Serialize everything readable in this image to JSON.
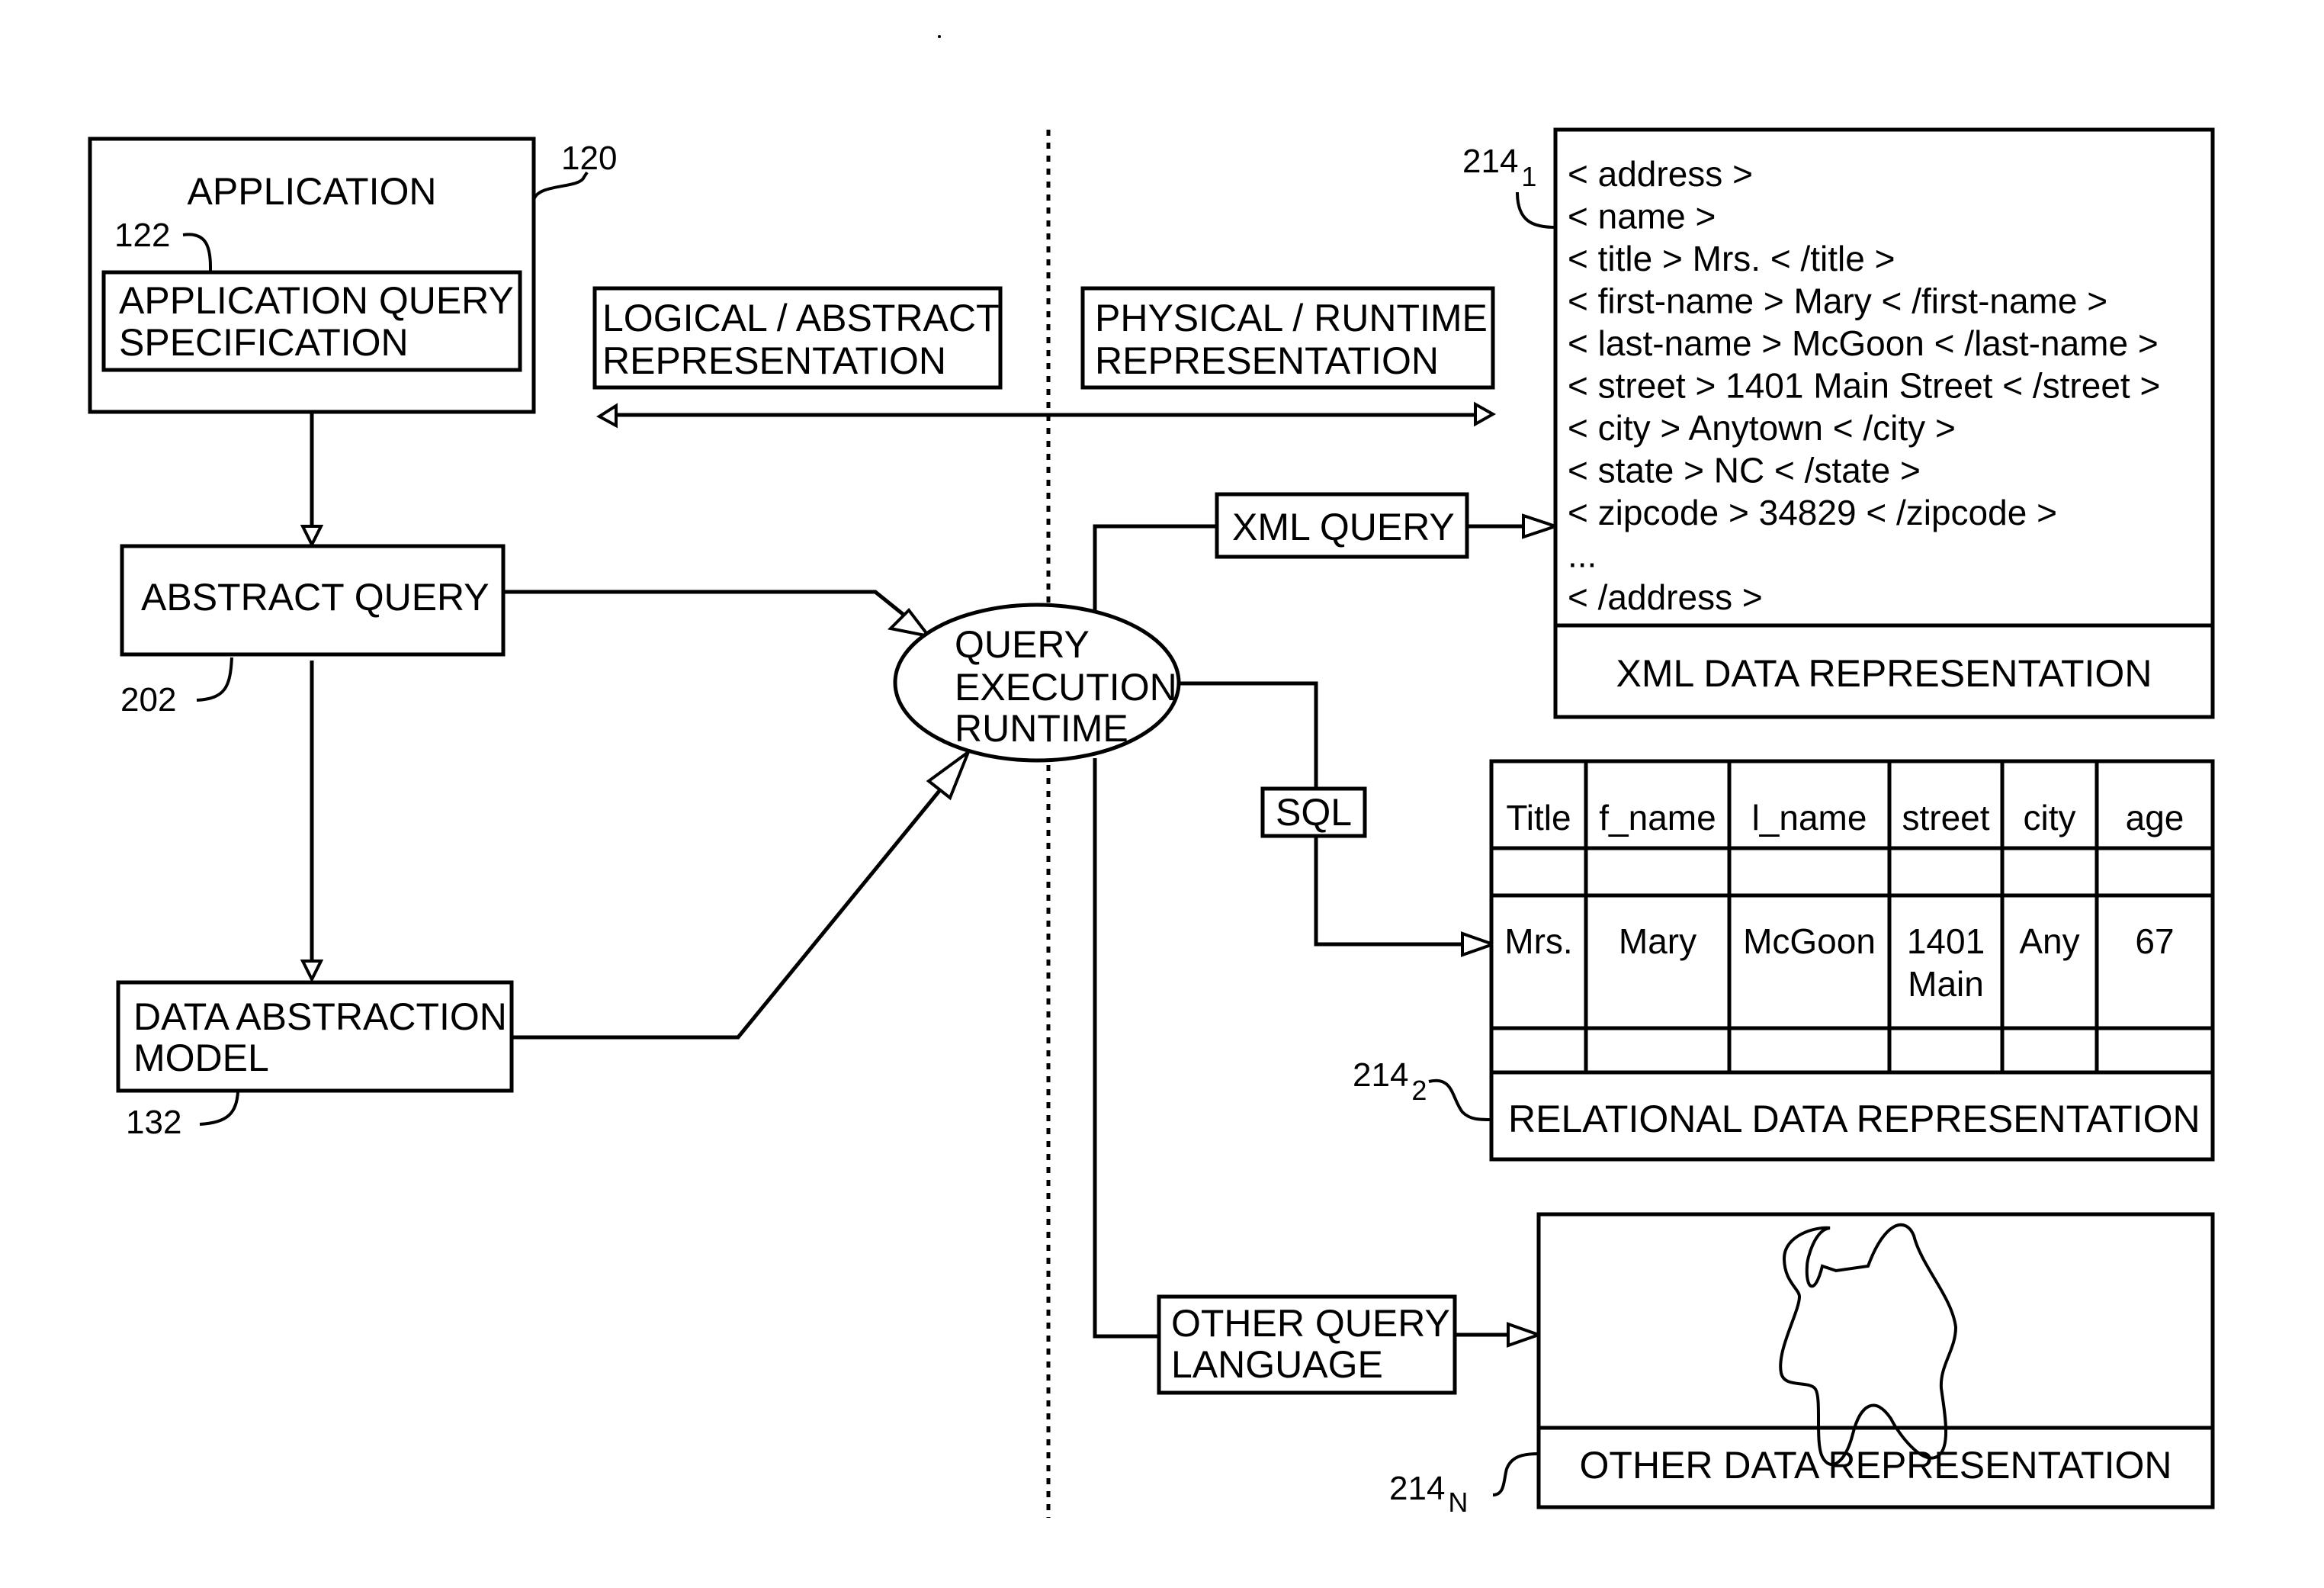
{
  "left_side": {
    "application": {
      "title": "APPLICATION",
      "ref": "120",
      "inner": {
        "ref": "122",
        "lines": [
          "APPLICATION QUERY",
          "SPECIFICATION"
        ]
      }
    },
    "abstract_query": {
      "label": "ABSTRACT QUERY",
      "ref": "202"
    },
    "data_abstraction_model": {
      "lines": [
        "DATA ABSTRACTION",
        "MODEL"
      ],
      "ref": "132"
    }
  },
  "headers": {
    "logical": [
      "LOGICAL / ABSTRACT",
      "REPRESENTATION"
    ],
    "physical": [
      "PHYSICAL / RUNTIME",
      "REPRESENTATION"
    ]
  },
  "runtime": {
    "lines": [
      "QUERY",
      "EXECUTION",
      "RUNTIME"
    ]
  },
  "queries": {
    "xml": "XML QUERY",
    "sql": "SQL",
    "other": [
      "OTHER QUERY",
      "LANGUAGE"
    ]
  },
  "xml_repr": {
    "ref": "214",
    "ref_sub": "1",
    "lines": [
      "< address >",
      "< name >",
      "< title > Mrs. < /title >",
      "< first-name > Mary < /first-name >",
      "< last-name > McGoon < /last-name >",
      "< street > 1401 Main Street < /street >",
      "< city >  Anytown < /city >",
      "< state > NC < /state >",
      "< zipcode > 34829 < /zipcode >",
      "...",
      "< /address >"
    ],
    "caption": "XML DATA REPRESENTATION"
  },
  "relational_repr": {
    "ref": "214",
    "ref_sub": "2",
    "columns": [
      "Title",
      "f_name",
      "l_name",
      "street",
      "city",
      "age"
    ],
    "row": [
      [
        "Mrs."
      ],
      [
        "Mary"
      ],
      [
        "McGoon"
      ],
      [
        "1401",
        "Main"
      ],
      [
        "Any"
      ],
      [
        "67"
      ]
    ],
    "caption": "RELATIONAL DATA REPRESENTATION"
  },
  "other_repr": {
    "ref": "214",
    "ref_sub": "N",
    "caption": "OTHER DATA REPRESENTATION"
  }
}
